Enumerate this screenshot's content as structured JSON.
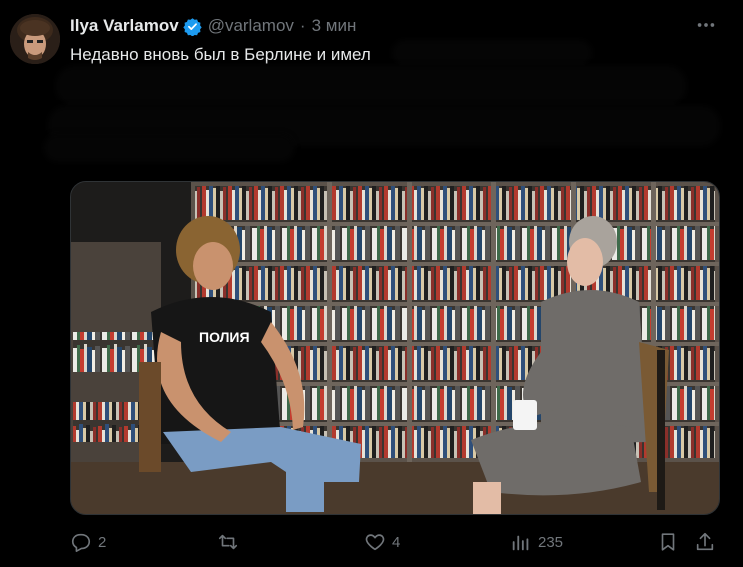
{
  "author": {
    "name": "Ilya Varlamov",
    "handle": "@varlamov",
    "separator": "·",
    "time": "3 мин"
  },
  "tweet": {
    "text": "Недавно вновь был в Берлине и имел"
  },
  "actions": {
    "replies": "2",
    "likes": "4",
    "views": "235"
  },
  "icons": {
    "verified": "verified-badge-icon",
    "more": "more-icon",
    "reply": "reply-icon",
    "retweet": "retweet-icon",
    "like": "heart-icon",
    "views": "views-icon",
    "bookmark": "bookmark-icon",
    "share": "share-icon"
  },
  "colors": {
    "background": "#000000",
    "text": "#e7e9ea",
    "muted": "#71767b",
    "verified": "#1d9bf0"
  }
}
